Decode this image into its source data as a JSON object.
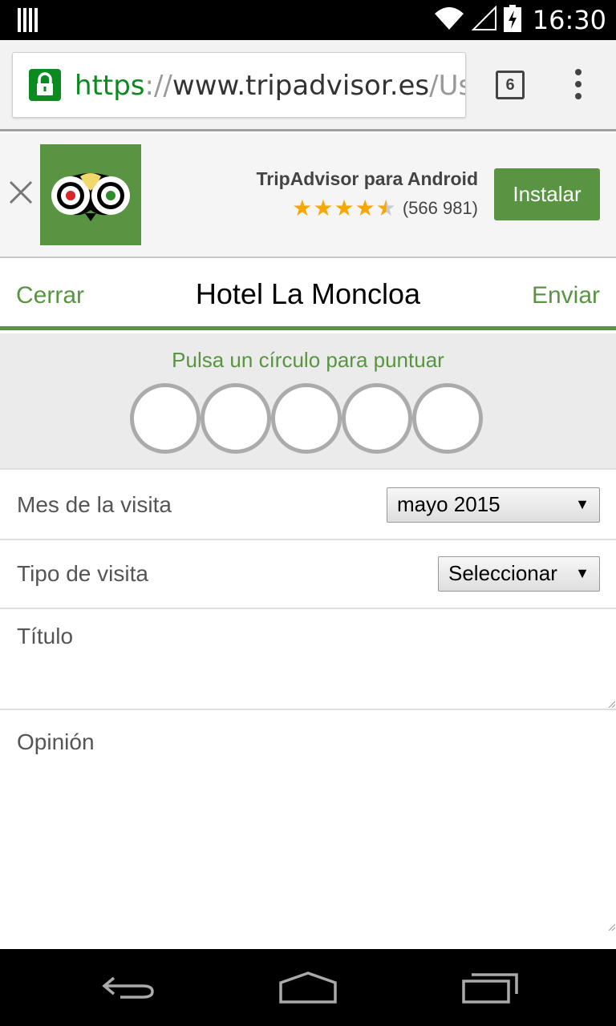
{
  "status_bar": {
    "time": "16:30"
  },
  "browser": {
    "url_scheme": "https",
    "url_separator": "://",
    "url_host": "www.tripadvisor.es",
    "url_path": "/Use",
    "tab_count": "6"
  },
  "app_banner": {
    "app_name": "TripAdvisor para Android",
    "rating_stars": 4.5,
    "rating_count": "(566 981)",
    "install_label": "Instalar",
    "brand_color": "#589442",
    "star_color": "#f7a800"
  },
  "header": {
    "cancel_label": "Cerrar",
    "title": "Hotel La Moncloa",
    "send_label": "Enviar"
  },
  "rating": {
    "prompt": "Pulsa un círculo para puntuar",
    "bubbles": 5,
    "selected": 0
  },
  "form": {
    "visit_month_label": "Mes de la visita",
    "visit_month_value": "mayo 2015",
    "visit_type_label": "Tipo de visita",
    "visit_type_value": "Seleccionar",
    "title_placeholder": "Título",
    "review_placeholder": "Opinión"
  }
}
